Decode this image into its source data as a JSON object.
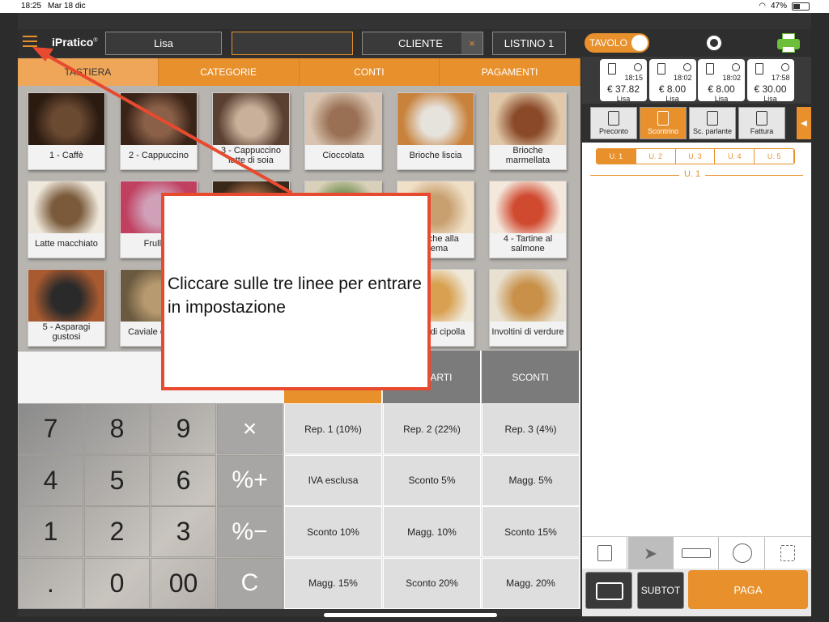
{
  "statusbar": {
    "time": "18:25",
    "date": "Mar 18 dic",
    "battery": "47%"
  },
  "header": {
    "logo": "iPratico",
    "operator": "Lisa",
    "table_field": "",
    "customer": "CLIENTE",
    "customer_clear": "×",
    "price_list": "LISTINO 1",
    "toggle_label": "TAVOLO"
  },
  "tabs": [
    "TASTIERA",
    "CATEGORIE",
    "CONTI",
    "PAGAMENTI"
  ],
  "products": [
    [
      "1 - Caffè",
      "2 - Cappuccino",
      "3 - Cappuccino latte di soia",
      "Cioccolata",
      "Brioche liscia",
      "Brioche marmellata"
    ],
    [
      "Latte macchiato",
      "Frullato",
      "",
      "",
      "Brioche alla crema",
      "4 - Tartine al salmone"
    ],
    [
      "5 - Asparagi gustosi",
      "Caviale con q...",
      "",
      "",
      "Anelli di cipolla",
      "Involtini di verdure"
    ]
  ],
  "keypad": [
    [
      "7",
      "8",
      "9",
      "×"
    ],
    [
      "4",
      "5",
      "6",
      "%+"
    ],
    [
      "1",
      "2",
      "3",
      "%−"
    ],
    [
      ".",
      "0",
      "00",
      "C"
    ]
  ],
  "function_headers": [
    "",
    "REPARTI",
    "SCONTI"
  ],
  "function_buttons": [
    [
      "Rep. 1 (10%)",
      "Rep. 2 (22%)",
      "Rep. 3 (4%)"
    ],
    [
      "IVA esclusa",
      "Sconto 5%",
      "Magg. 5%"
    ],
    [
      "Sconto 10%",
      "Magg. 10%",
      "Sconto 15%"
    ],
    [
      "Magg. 15%",
      "Sconto 20%",
      "Magg. 20%"
    ]
  ],
  "orders": [
    {
      "time": "18:15",
      "amount": "€ 37.82",
      "user": "Lisa"
    },
    {
      "time": "18:02",
      "amount": "€ 8.00",
      "user": "Lisa"
    },
    {
      "time": "18:02",
      "amount": "€ 8.00",
      "user": "Lisa"
    },
    {
      "time": "17:58",
      "amount": "€ 30.00",
      "user": "Lisa"
    }
  ],
  "doc_tabs": [
    "Preconto",
    "Scontrino",
    "Sc. parlante",
    "Fattura"
  ],
  "units": [
    "U. 1",
    "U. 2",
    "U. 3",
    "U. 4",
    "U. 5"
  ],
  "active_unit_label": "U. 1",
  "bottom": {
    "subtot": "SUBTOT",
    "pay": "PAGA"
  },
  "callout": "Cliccare sulle tre linee per entrare in impostazione",
  "colors": {
    "accent": "#e8902c",
    "callout_border": "#e84a30"
  }
}
